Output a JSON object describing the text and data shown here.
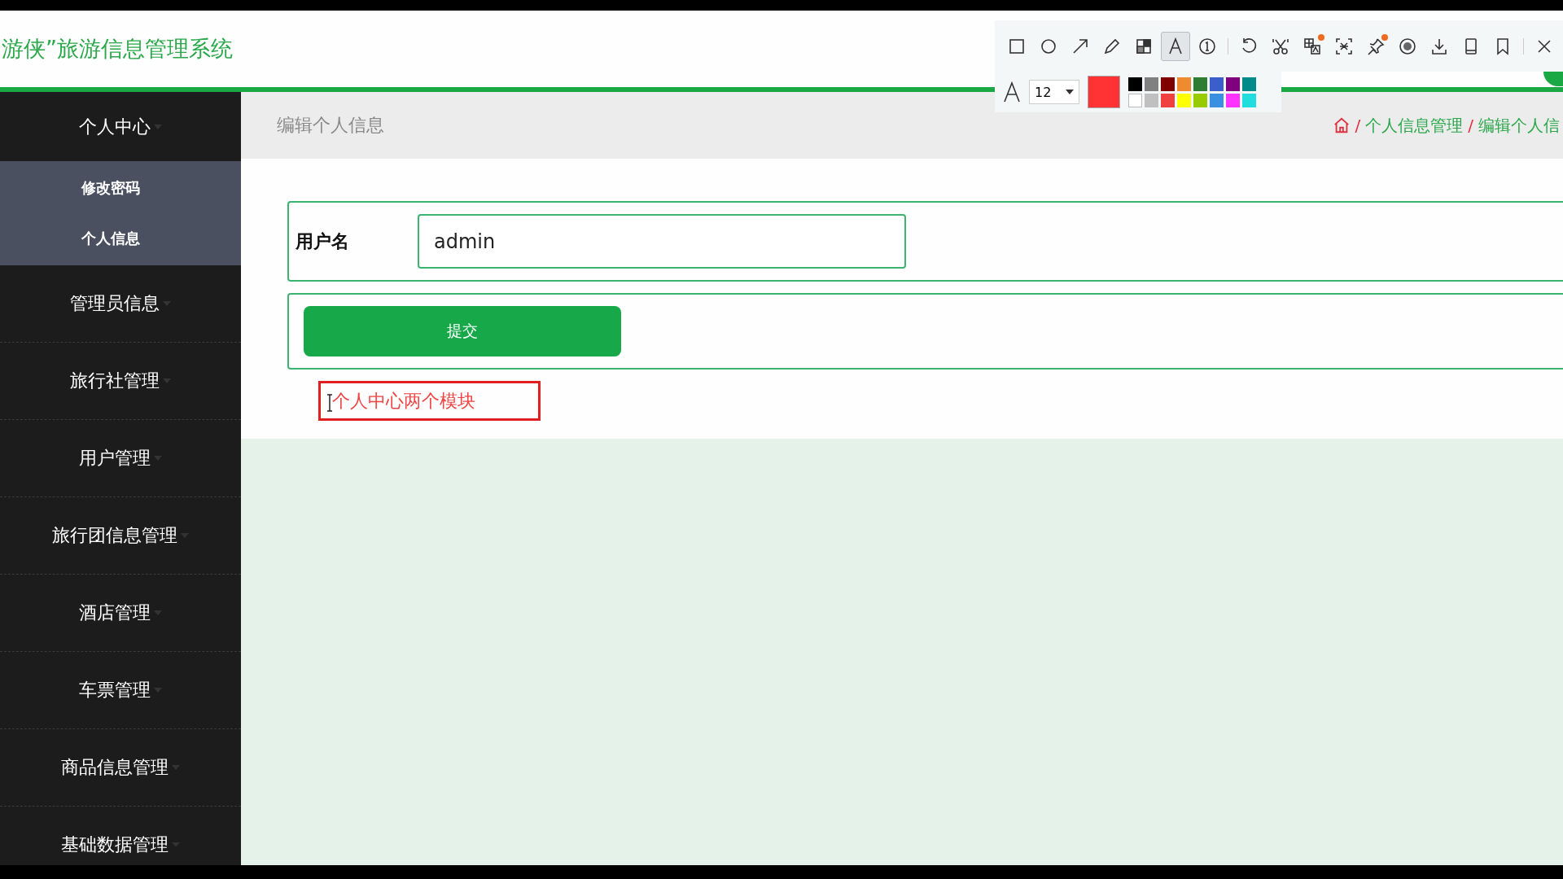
{
  "header": {
    "title": "游侠”旅游信息管理系统"
  },
  "sidebar": {
    "items": [
      {
        "label": "个人中心",
        "expanded": true,
        "children": [
          {
            "label": "修改密码"
          },
          {
            "label": "个人信息"
          }
        ]
      },
      {
        "label": "管理员信息",
        "expanded": false
      },
      {
        "label": "旅行社管理",
        "expanded": false
      },
      {
        "label": "用户管理",
        "expanded": false
      },
      {
        "label": "旅行团信息管理",
        "expanded": false
      },
      {
        "label": "酒店管理",
        "expanded": false
      },
      {
        "label": "车票管理",
        "expanded": false
      },
      {
        "label": "商品信息管理",
        "expanded": false
      },
      {
        "label": "基础数据管理",
        "expanded": false
      }
    ]
  },
  "page": {
    "title": "编辑个人信息",
    "breadcrumb": [
      {
        "separator": "/",
        "label": "个人信息管理"
      },
      {
        "separator": "/",
        "label": "编辑个人信"
      }
    ]
  },
  "form": {
    "fields": [
      {
        "label": "用户名",
        "value": "admin"
      }
    ],
    "submit": "提交"
  },
  "annotation": {
    "text": "个人中心两个模块"
  },
  "toolbar": {
    "tools": [
      {
        "kind": "rect",
        "selected": false,
        "dot": false
      },
      {
        "kind": "ellipse",
        "selected": false,
        "dot": false
      },
      {
        "kind": "arrow",
        "selected": false,
        "dot": false
      },
      {
        "kind": "pencil",
        "selected": false,
        "dot": false
      },
      {
        "kind": "mosaic",
        "selected": false,
        "dot": false
      },
      {
        "kind": "text",
        "selected": true,
        "dot": false
      },
      {
        "kind": "number",
        "selected": false,
        "dot": false
      },
      {
        "kind": "undo",
        "selected": false,
        "dot": false
      },
      {
        "kind": "cut",
        "selected": false,
        "dot": false
      },
      {
        "kind": "translate",
        "selected": false,
        "dot": true
      },
      {
        "kind": "ocr",
        "selected": false,
        "dot": false
      },
      {
        "kind": "pin",
        "selected": false,
        "dot": true
      },
      {
        "kind": "record",
        "selected": false,
        "dot": false
      },
      {
        "kind": "download",
        "selected": false,
        "dot": false
      },
      {
        "kind": "phone",
        "selected": false,
        "dot": false
      },
      {
        "kind": "bookmark",
        "selected": false,
        "dot": false
      },
      {
        "kind": "close",
        "selected": false,
        "dot": false
      }
    ],
    "font_size": "12",
    "palette": [
      {
        "color": "#000000"
      },
      {
        "color": "#808080"
      },
      {
        "color": "#800000"
      },
      {
        "color": "#f08a30"
      },
      {
        "color": "#2e7d32"
      },
      {
        "color": "#3a5fcd"
      },
      {
        "color": "#800080"
      },
      {
        "color": "#008b8b"
      },
      {
        "color": "#ffffff"
      },
      {
        "color": "#c0c0c0"
      },
      {
        "color": "#f04040"
      },
      {
        "color": "#ffff00"
      },
      {
        "color": "#99cc00"
      },
      {
        "color": "#3a8fe0"
      },
      {
        "color": "#ff33ff"
      },
      {
        "color": "#22dddd"
      }
    ]
  }
}
